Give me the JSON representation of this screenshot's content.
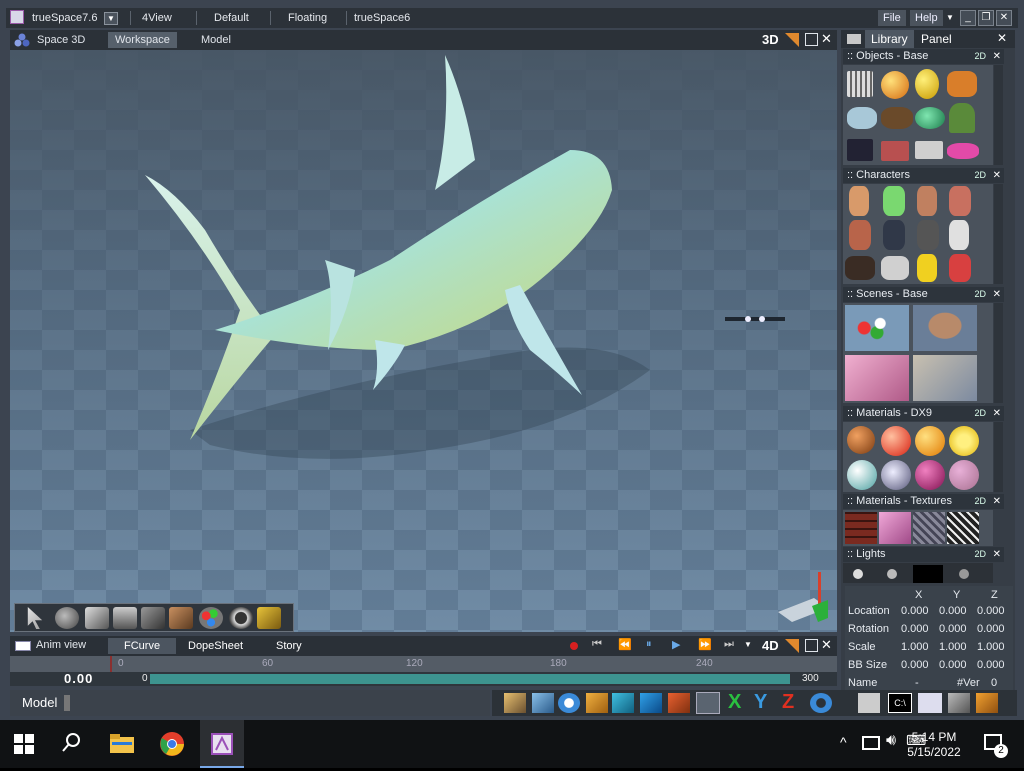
{
  "titlebar": {
    "app_title": "trueSpace7.6",
    "tabs": [
      "4View",
      "Default",
      "Floating",
      "trueSpace6"
    ],
    "menu": [
      "File",
      "Help"
    ]
  },
  "viewport_header": {
    "title": "Space 3D",
    "tabs": [
      "Workspace",
      "Model"
    ],
    "mode": "3D"
  },
  "library": {
    "tabs": [
      "Library",
      "Panel"
    ],
    "sections": [
      {
        "title": ":: Objects - Base",
        "tag": "2D"
      },
      {
        "title": ":: Characters",
        "tag": "2D"
      },
      {
        "title": ":: Scenes - Base",
        "tag": "2D"
      },
      {
        "title": ":: Materials - DX9",
        "tag": "2D"
      },
      {
        "title": ":: Materials - Textures",
        "tag": "2D"
      },
      {
        "title": ":: Lights",
        "tag": "2D"
      }
    ]
  },
  "props": {
    "columns": [
      "X",
      "Y",
      "Z"
    ],
    "rows": [
      {
        "label": "Location",
        "values": [
          "0.000",
          "0.000",
          "0.000"
        ]
      },
      {
        "label": "Rotation",
        "values": [
          "0.000",
          "0.000",
          "0.000"
        ]
      },
      {
        "label": "Scale",
        "values": [
          "1.000",
          "1.000",
          "1.000"
        ]
      },
      {
        "label": "BB Size",
        "values": [
          "0.000",
          "0.000",
          "0.000"
        ]
      },
      {
        "label": "Name",
        "values": [
          "-",
          "#Ver",
          "0"
        ]
      }
    ]
  },
  "anim": {
    "title": "Anim view",
    "tabs": [
      "FCurve",
      "DopeSheet",
      "Story"
    ],
    "mode": "4D",
    "ruler_ticks": [
      "0",
      "60",
      "120",
      "180",
      "240"
    ],
    "time_value": "0.00",
    "start_frame": "0",
    "end_frame": "300"
  },
  "status": {
    "label": "Model"
  },
  "taskbar": {
    "time": "5:14 PM",
    "date": "5/15/2022",
    "notification_count": "2"
  }
}
